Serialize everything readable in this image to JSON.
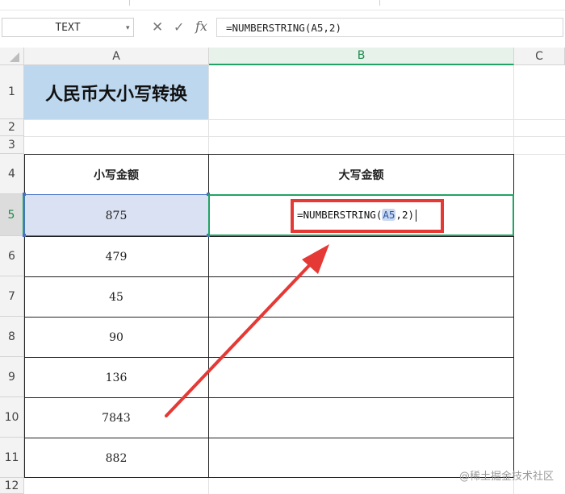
{
  "name_box": {
    "value": "TEXT"
  },
  "formula_bar": {
    "cancel_glyph": "✕",
    "enter_glyph": "✓",
    "fx_label": "fx",
    "formula": "=NUMBERSTRING(A5,2)"
  },
  "columns": [
    "A",
    "B",
    "C"
  ],
  "rows": [
    "1",
    "2",
    "3",
    "4",
    "5",
    "6",
    "7",
    "8",
    "9",
    "10",
    "11",
    "12"
  ],
  "cells": {
    "title": "人民币大小写转换",
    "header_a": "小写金额",
    "header_b": "大写金额",
    "values": [
      "875",
      "479",
      "45",
      "90",
      "136",
      "7843",
      "882"
    ]
  },
  "edit": {
    "prefix": "=NUMBERSTRING(",
    "ref": "A5",
    "suffix": ",2)"
  },
  "colors": {
    "title_fill": "#bdd7ee",
    "selection_fill": "#d9e1f2",
    "active_green": "#21a366",
    "annotation_red": "#e53935"
  },
  "watermark": "@稀土掘金技术社区"
}
